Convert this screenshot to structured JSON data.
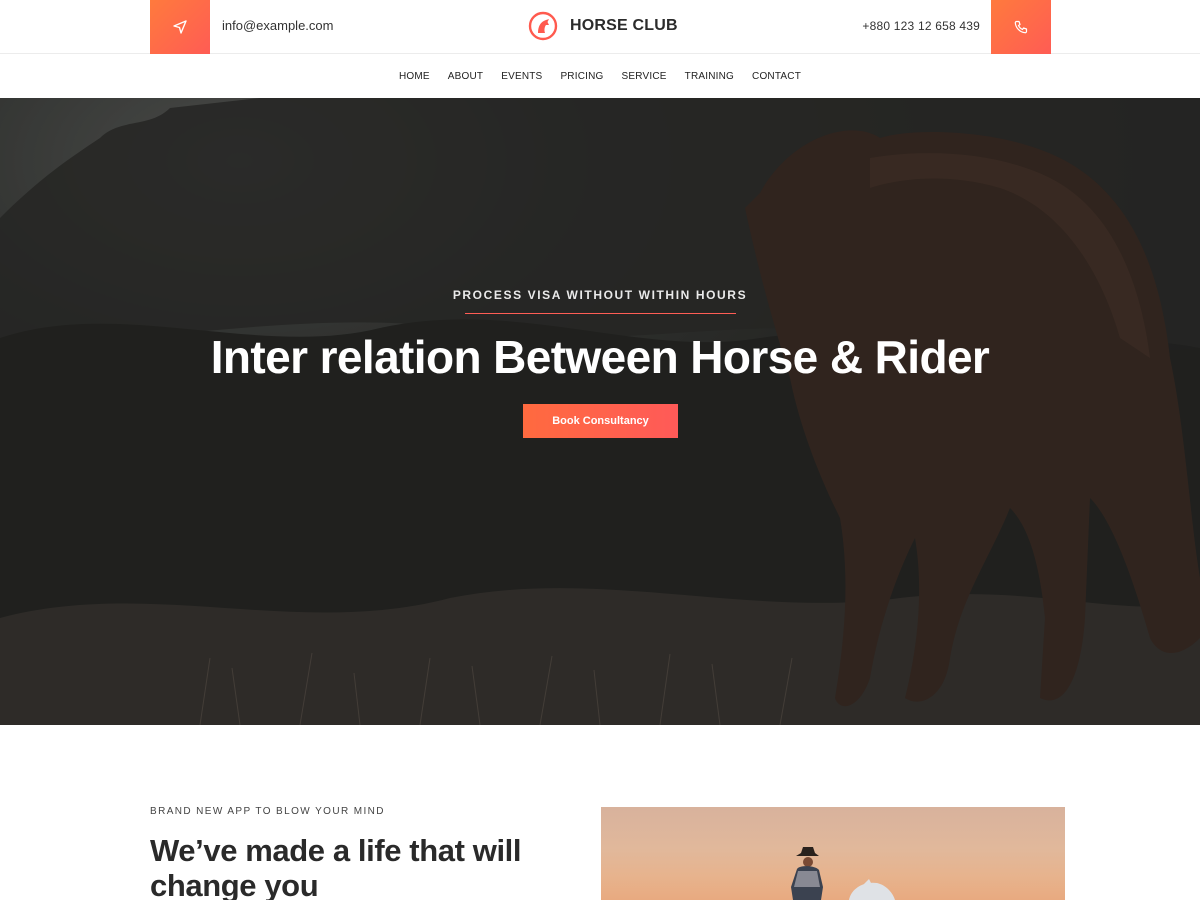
{
  "topbar": {
    "email": "info@example.com",
    "phone": "+880 123 12 658 439",
    "logo_text": "HORSE CLUB",
    "send_icon": "paper-plane-icon",
    "phone_icon": "phone-icon"
  },
  "nav": {
    "items": [
      "HOME",
      "ABOUT",
      "EVENTS",
      "PRICING",
      "SERVICE",
      "TRAINING",
      "CONTACT"
    ]
  },
  "hero": {
    "kicker": "PROCESS VISA WITHOUT WITHIN HOURS",
    "title": "Inter relation Between Horse & Rider",
    "button_label": "Book Consultancy"
  },
  "intro": {
    "kicker": "BRAND NEW APP TO BLOW YOUR MIND",
    "title": "We’ve made a life that will change you"
  },
  "colors": {
    "accent": "#ff6a3f",
    "accent_2": "#ff5a58"
  }
}
